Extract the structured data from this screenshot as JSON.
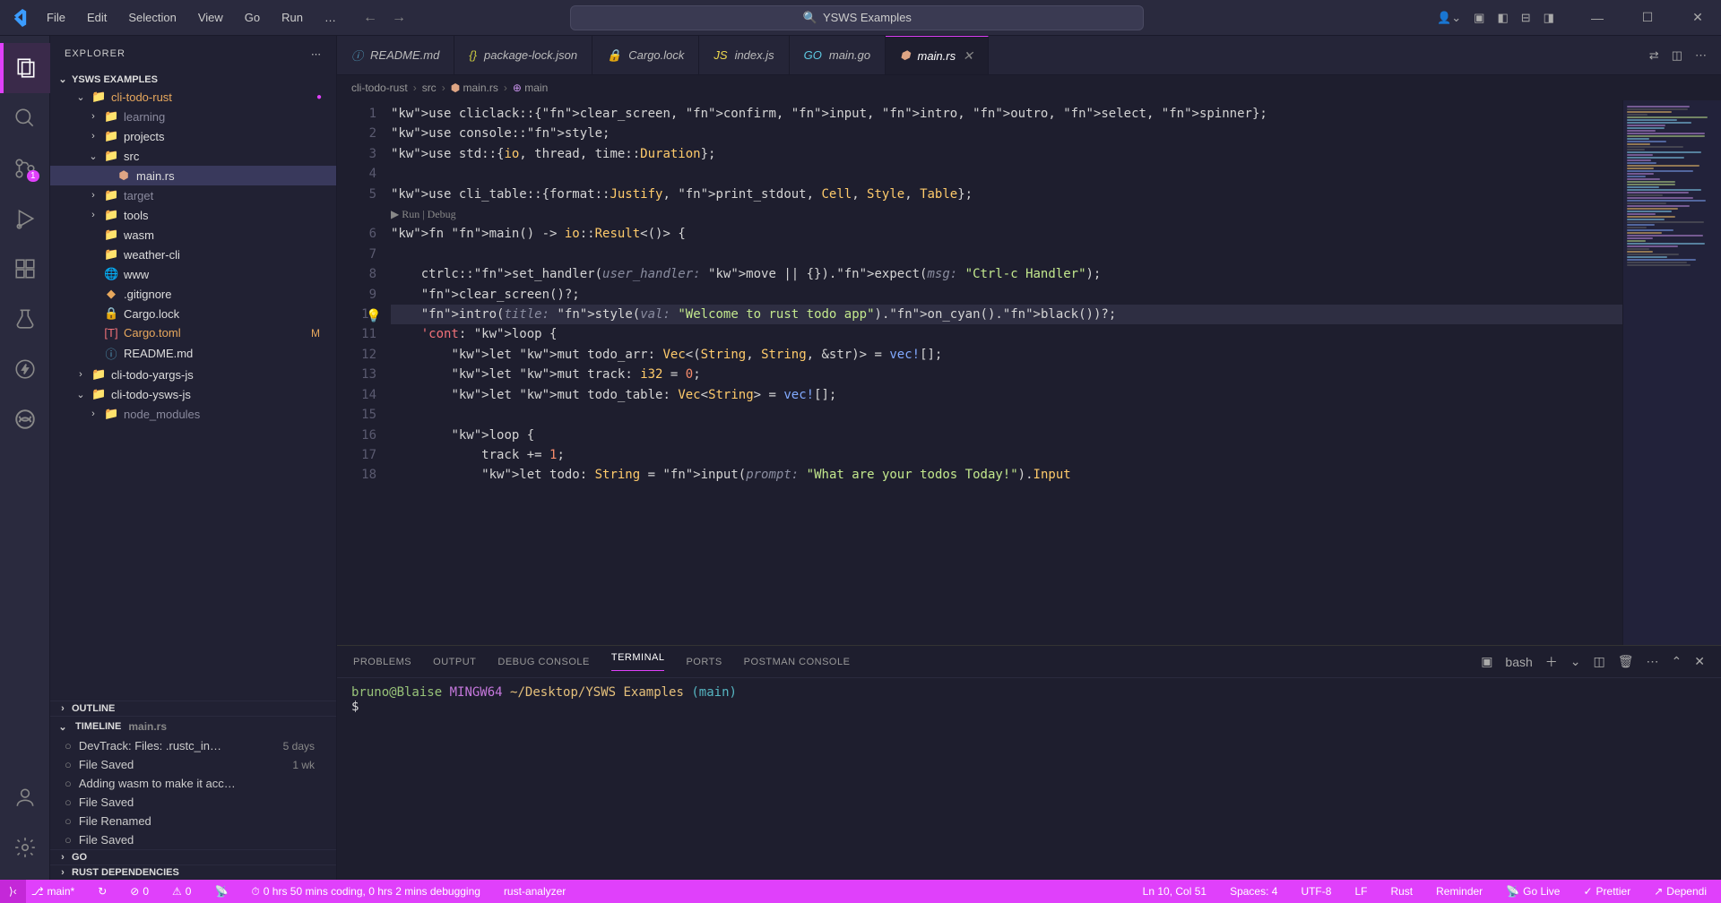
{
  "window_title": "YSWS Examples",
  "menu": [
    "File",
    "Edit",
    "Selection",
    "View",
    "Go",
    "Run",
    "…"
  ],
  "sidebar": {
    "title": "EXPLORER",
    "workspace": "YSWS EXAMPLES",
    "tree": [
      {
        "indent": 1,
        "chev": "⌄",
        "icon": "folder",
        "label": "cli-todo-rust",
        "class": "orange",
        "dot": true
      },
      {
        "indent": 2,
        "chev": "›",
        "icon": "folder",
        "label": "learning",
        "class": "muted"
      },
      {
        "indent": 2,
        "chev": "›",
        "icon": "folder-blue",
        "label": "projects"
      },
      {
        "indent": 2,
        "chev": "⌄",
        "icon": "folder-green",
        "label": "src"
      },
      {
        "indent": 3,
        "chev": "",
        "icon": "rust",
        "label": "main.rs",
        "selected": true
      },
      {
        "indent": 2,
        "chev": "›",
        "icon": "folder",
        "label": "target",
        "class": "muted"
      },
      {
        "indent": 2,
        "chev": "›",
        "icon": "folder-blue",
        "label": "tools"
      },
      {
        "indent": 2,
        "chev": "",
        "icon": "folder",
        "label": "wasm"
      },
      {
        "indent": 2,
        "chev": "",
        "icon": "folder",
        "label": "weather-cli"
      },
      {
        "indent": 2,
        "chev": "",
        "icon": "html",
        "label": "www"
      },
      {
        "indent": 2,
        "chev": "",
        "icon": "git",
        "label": ".gitignore"
      },
      {
        "indent": 2,
        "chev": "",
        "icon": "lock",
        "label": "Cargo.lock"
      },
      {
        "indent": 2,
        "chev": "",
        "icon": "toml",
        "label": "Cargo.toml",
        "class": "orange",
        "mod": "M"
      },
      {
        "indent": 2,
        "chev": "",
        "icon": "md",
        "label": "README.md"
      },
      {
        "indent": 1,
        "chev": "›",
        "icon": "folder",
        "label": "cli-todo-yargs-js"
      },
      {
        "indent": 1,
        "chev": "⌄",
        "icon": "folder",
        "label": "cli-todo-ysws-js"
      },
      {
        "indent": 2,
        "chev": "›",
        "icon": "folder-green",
        "label": "node_modules",
        "class": "muted"
      }
    ],
    "outline": "OUTLINE",
    "timeline": {
      "title": "TIMELINE",
      "subtitle": "main.rs",
      "items": [
        {
          "label": "DevTrack: Files: .rustc_in…",
          "time": "5 days"
        },
        {
          "label": "File Saved",
          "time": "1 wk"
        },
        {
          "label": "Adding wasm to make it acc…",
          "time": ""
        },
        {
          "label": "File Saved",
          "time": ""
        },
        {
          "label": "File Renamed",
          "time": ""
        },
        {
          "label": "File Saved",
          "time": ""
        }
      ]
    },
    "go": "GO",
    "rust": "RUST DEPENDENCIES"
  },
  "tabs": [
    {
      "icon": "md",
      "label": "README.md"
    },
    {
      "icon": "json",
      "label": "package-lock.json"
    },
    {
      "icon": "lock",
      "label": "Cargo.lock"
    },
    {
      "icon": "js",
      "label": "index.js"
    },
    {
      "icon": "go",
      "label": "main.go"
    },
    {
      "icon": "rust",
      "label": "main.rs",
      "active": true,
      "close": true
    }
  ],
  "breadcrumb": [
    "cli-todo-rust",
    "src",
    "main.rs",
    "main"
  ],
  "codelens": "▶ Run | Debug",
  "code_lines": [
    "use cliclack::{clear_screen, confirm, input, intro, outro, select, spinner};",
    "use console::style;",
    "use std::{io, thread, time::Duration};",
    "",
    "use cli_table::{format::Justify, print_stdout, Cell, Style, Table};",
    "fn main() -> io::Result<()> {",
    "",
    "    ctrlc::set_handler(user_handler: move || {}).expect(msg: \"Ctrl-c Handler\");",
    "    clear_screen()?;",
    "    intro(title: style(val: \"Welcome to rust todo app\").on_cyan().black())?;",
    "    'cont: loop {",
    "        let mut todo_arr: Vec<(String, String, &str)> = vec![];",
    "        let mut track: i32 = 0;",
    "        let mut todo_table: Vec<String> = vec![];",
    "",
    "        loop {",
    "            track += 1;",
    "            let todo: String = input(prompt: \"What are your todos Today!\").Input"
  ],
  "line_numbers": [
    "1",
    "2",
    "3",
    "4",
    "5",
    "6",
    "7",
    "8",
    "9",
    "10",
    "11",
    "12",
    "13",
    "14",
    "15",
    "16",
    "17",
    "18"
  ],
  "highlighted_line": 10,
  "panel": {
    "tabs": [
      "PROBLEMS",
      "OUTPUT",
      "DEBUG CONSOLE",
      "TERMINAL",
      "PORTS",
      "POSTMAN CONSOLE"
    ],
    "active": "TERMINAL",
    "shell": "bash",
    "terminal": {
      "user": "bruno@Blaise",
      "env": "MINGW64",
      "path": "~/Desktop/YSWS Examples",
      "branch": "(main)"
    }
  },
  "statusbar": {
    "left": [
      {
        "icon": "⎇",
        "text": "main*"
      },
      {
        "icon": "↻",
        "text": ""
      },
      {
        "icon": "⊘",
        "text": "0"
      },
      {
        "icon": "⚠",
        "text": "0"
      },
      {
        "icon": "📡",
        "text": ""
      },
      {
        "icon": "⏱",
        "text": "0 hrs 50 mins coding, 0 hrs 2 mins debugging"
      },
      {
        "text": "rust-analyzer"
      }
    ],
    "right": [
      {
        "text": "Ln 10, Col 51"
      },
      {
        "text": "Spaces: 4"
      },
      {
        "text": "UTF-8"
      },
      {
        "text": "LF"
      },
      {
        "text": "Rust"
      },
      {
        "text": "Reminder"
      },
      {
        "icon": "📡",
        "text": "Go Live"
      },
      {
        "icon": "✓",
        "text": "Prettier"
      },
      {
        "icon": "↗",
        "text": "Dependi"
      }
    ]
  },
  "scm_badge": "1"
}
